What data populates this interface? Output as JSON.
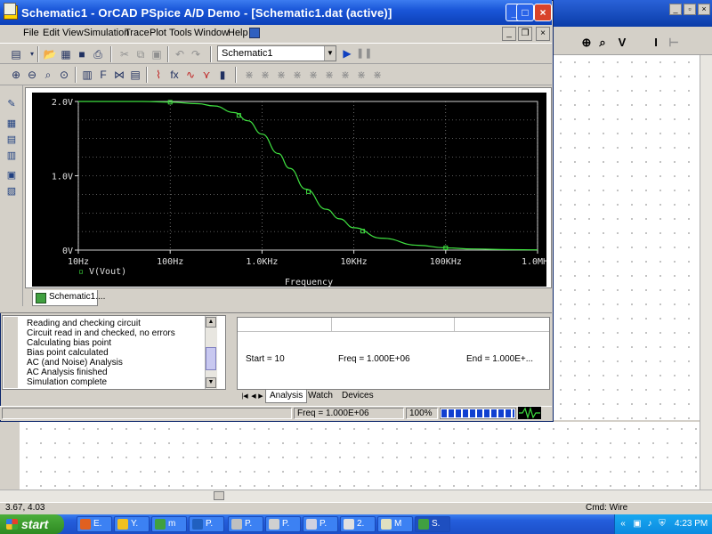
{
  "background_app": {
    "toolbar_icons": [
      "zoom-in-icon",
      "zoom-area-icon",
      "voltage-marker-icon",
      "current-marker-icon",
      "power-marker-icon"
    ],
    "toolbar_glyphs": [
      "⊕",
      "⌕",
      "V",
      "I",
      "⊢"
    ],
    "status_coords": "3.67, 4.03",
    "status_cmd": "Cmd: Wire"
  },
  "window": {
    "title": "Schematic1 - OrCAD PSpice A/D Demo  - [Schematic1.dat (active)]",
    "controls": [
      "_",
      "□",
      "×"
    ]
  },
  "menu": {
    "items": [
      "File",
      "Edit",
      "View",
      "Simulation",
      "Trace",
      "Plot",
      "Tools",
      "Window",
      "Help"
    ]
  },
  "toolbar": {
    "sim_profile": "Schematic1",
    "run_glyph": "▶",
    "pause_glyph": "❚❚"
  },
  "plot": {
    "trace_label": "V(Vout)",
    "trace_marker": "▫",
    "trace_color": "#3fe040",
    "background": "#000000",
    "grid_color": "#b0b0b0",
    "text_color": "#e0e0e0"
  },
  "chart_data": {
    "type": "line",
    "title": "",
    "xlabel": "Frequency",
    "ylabel": "",
    "x_scale": "log",
    "xlim": [
      10,
      1000000
    ],
    "ylim": [
      0,
      2.0
    ],
    "x_ticks": [
      10,
      100,
      1000,
      10000,
      100000,
      1000000
    ],
    "x_tick_labels": [
      "10Hz",
      "100Hz",
      "1.0KHz",
      "10KHz",
      "100KHz",
      "1.0MHz"
    ],
    "y_ticks": [
      0,
      1.0,
      2.0
    ],
    "y_tick_labels": [
      "0V",
      "1.0V",
      "2.0V"
    ],
    "grid": true,
    "legend": "bottom-left",
    "series": [
      {
        "name": "V(Vout)",
        "x": [
          10,
          20,
          50,
          100,
          200,
          300,
          500,
          700,
          1000,
          1500,
          2000,
          3000,
          5000,
          7000,
          10000,
          20000,
          50000,
          100000,
          200000,
          500000,
          1000000
        ],
        "y": [
          2.0,
          2.0,
          2.0,
          1.99,
          1.97,
          1.94,
          1.85,
          1.74,
          1.56,
          1.3,
          1.1,
          0.82,
          0.55,
          0.42,
          0.3,
          0.16,
          0.065,
          0.03,
          0.016,
          0.006,
          0.003
        ],
        "marker_x": [
          100,
          1000,
          10000,
          100000
        ]
      }
    ]
  },
  "doc_tab": "Schematic1....",
  "output": {
    "lines": [
      "Reading and checking circuit",
      "Circuit read in and checked, no errors",
      "Calculating bias point",
      "Bias point calculated",
      "AC (and Noise) Analysis",
      "AC Analysis finished",
      "Simulation complete"
    ]
  },
  "sim_status": {
    "start": "Start = 10",
    "freq": "Freq = 1.000E+06",
    "end": "End = 1.000E+...",
    "tabs": [
      "Analysis",
      "Watch",
      "Devices"
    ]
  },
  "status_bar": {
    "freq": "Freq = 1.000E+06",
    "percent": "100%",
    "progress": 1.0
  },
  "taskbar": {
    "start_label": "start",
    "buttons": [
      {
        "label": "E.",
        "icon_color": "#e06020"
      },
      {
        "label": "Y.",
        "icon_color": "#f0c020"
      },
      {
        "label": "m",
        "icon_color": "#40a040"
      },
      {
        "label": "P.",
        "icon_color": "#2060c0"
      },
      {
        "label": "P.",
        "icon_color": "#c0c0c0"
      },
      {
        "label": "P.",
        "icon_color": "#d0d0d0"
      },
      {
        "label": "P.",
        "icon_color": "#d0d0e0"
      },
      {
        "label": "2.",
        "icon_color": "#e0e0e0"
      },
      {
        "label": "M",
        "icon_color": "#e0e0c0"
      },
      {
        "label": "S.",
        "icon_color": "#40a040"
      }
    ],
    "clock": "4:23 PM"
  }
}
